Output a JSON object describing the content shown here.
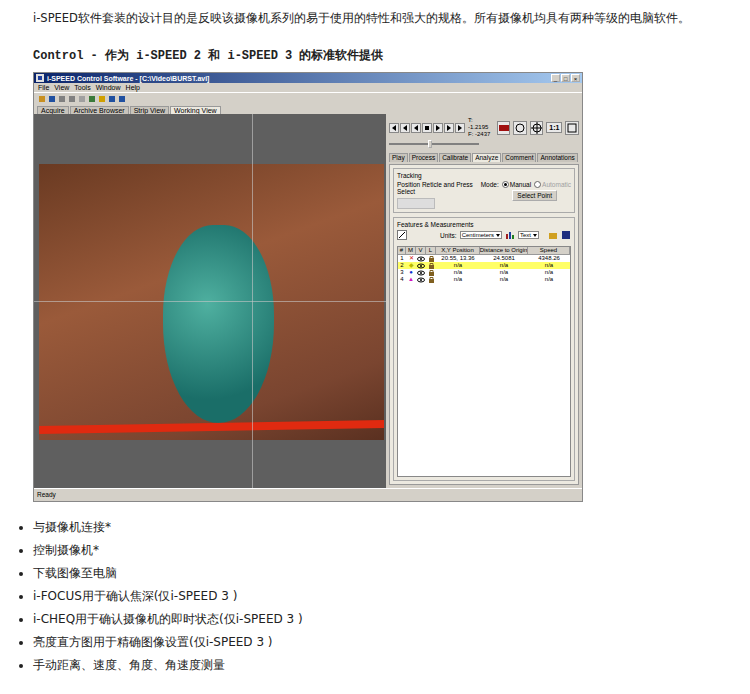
{
  "intro": "i-SPEED软件套装的设计目的是反映该摄像机系列的易于使用的特性和强大的规格。所有摄像机均具有两种等级的电脑软件。",
  "heading": "Control - 作为 i-SPEED 2 和 i-SPEED 3 的标准软件提供",
  "app": {
    "title": "i-SPEED Control Software - [C:\\Video\\BURST.avi]",
    "window_buttons": [
      "_",
      "□",
      "×"
    ],
    "menu": [
      "File",
      "View",
      "Tools",
      "Window",
      "Help"
    ],
    "view_tabs": [
      {
        "label": "Acquire",
        "selected": false
      },
      {
        "label": "Archive Browser",
        "selected": false
      },
      {
        "label": "Strip View",
        "selected": false
      },
      {
        "label": "Working View",
        "selected": true
      }
    ],
    "time": "T: -1.2195",
    "frame": "F: -2437",
    "zoom": "1:1",
    "position": {
      "level": 0.45
    },
    "panel_tabs": [
      {
        "label": "Play",
        "selected": false
      },
      {
        "label": "Process",
        "selected": false
      },
      {
        "label": "Calibrate",
        "selected": false
      },
      {
        "label": "Analyze",
        "selected": true
      },
      {
        "label": "Comment",
        "selected": false
      },
      {
        "label": "Annotations",
        "selected": false
      }
    ],
    "tracking": {
      "title": "Tracking",
      "hint": "Position Reticle and Press Select",
      "mode_label": "Mode:",
      "modes": [
        {
          "label": "Manual",
          "selected": true,
          "disabled": false
        },
        {
          "label": "Automatic",
          "selected": false,
          "disabled": true
        }
      ],
      "select_button": "Select Point"
    },
    "features": {
      "title": "Features & Measurements",
      "units_label": "Units:",
      "units": "Centimeters",
      "display": "Text"
    },
    "table": {
      "columns": [
        "#",
        "M",
        "V",
        "L",
        "X,Y Position",
        "Distance to Origin",
        "Speed"
      ],
      "rows": [
        {
          "num": "1",
          "marker": "✕",
          "color": "#d01010",
          "selected": false,
          "cells": [
            "20.55, 13.36",
            "24.5081",
            "4348.26"
          ]
        },
        {
          "num": "2",
          "marker": "◆",
          "color": "#b8b800",
          "selected": true,
          "cells": [
            "n/a",
            "n/a",
            "n/a"
          ]
        },
        {
          "num": "3",
          "marker": "●",
          "color": "#1030d0",
          "selected": false,
          "cells": [
            "n/a",
            "n/a",
            "n/a"
          ]
        },
        {
          "num": "4",
          "marker": "▲",
          "color": "#d010c0",
          "selected": false,
          "cells": [
            "n/a",
            "n/a",
            "n/a"
          ]
        }
      ]
    },
    "status": "Ready"
  },
  "bullets": [
    "与摄像机连接*",
    "控制摄像机*",
    "下载图像至电脑",
    "i-FOCUS用于确认焦深(仅i-SPEED 3 )",
    "i-CHEQ用于确认摄像机的即时状态(仅i-SPEED 3 )",
    "亮度直方图用于精确图像设置(仅i-SPEED 3 )",
    "手动距离、速度、角度、角速度测量"
  ]
}
